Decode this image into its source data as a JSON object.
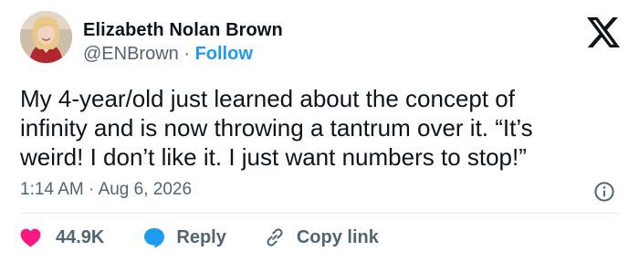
{
  "author": {
    "name": "Elizabeth Nolan Brown",
    "handle": "@ENBrown",
    "separator": "·",
    "follow_label": "Follow"
  },
  "tweet": {
    "lines": [
      "My 4-year/old just learned about the concept of",
      "infinity and is now throwing a tantrum over it. “It’s",
      "weird! I don’t like it. I just want numbers to stop!”"
    ],
    "time": "1:14 AM",
    "date": "Aug 6, 2026",
    "meta_separator": "·"
  },
  "actions": {
    "like_count": "44.9K",
    "reply_label": "Reply",
    "copy_label": "Copy link"
  },
  "colors": {
    "accent": "#1d9bf0",
    "like": "#f91880",
    "text": "#0f1419",
    "secondary": "#536471"
  },
  "icons": {
    "brand": "x-logo-icon",
    "info": "info-icon",
    "like": "heart-icon",
    "reply": "speech-bubble-icon",
    "copy": "link-icon"
  }
}
